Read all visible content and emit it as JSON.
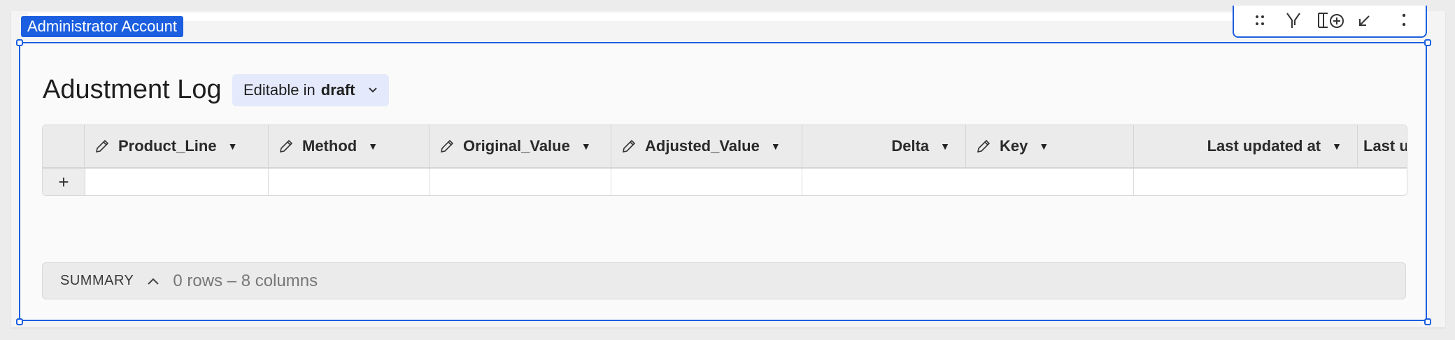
{
  "account_tag": "Administrator Account",
  "toolbar": {
    "icons": [
      "drag-handle-icon",
      "filter-icon",
      "add-column-icon",
      "collapse-icon",
      "more-options-icon"
    ]
  },
  "element": {
    "title": "Adustment Log",
    "mode_prefix": "Editable in",
    "mode_value": "draft"
  },
  "table": {
    "columns": [
      {
        "label": "Product_Line",
        "editable": true
      },
      {
        "label": "Method",
        "editable": true
      },
      {
        "label": "Original_Value",
        "editable": true
      },
      {
        "label": "Adjusted_Value",
        "editable": true
      },
      {
        "label": "Delta",
        "editable": false
      },
      {
        "label": "Key",
        "editable": true
      },
      {
        "label": "Last updated at",
        "editable": false
      },
      {
        "label": "Last u",
        "editable": false
      }
    ],
    "add_row_symbol": "+"
  },
  "summary": {
    "label": "SUMMARY",
    "count_text": "0 rows – 8 columns"
  },
  "colors": {
    "accent": "#1b5fe0",
    "pill_bg": "#e4eafb",
    "header_bg": "#ebebeb"
  }
}
